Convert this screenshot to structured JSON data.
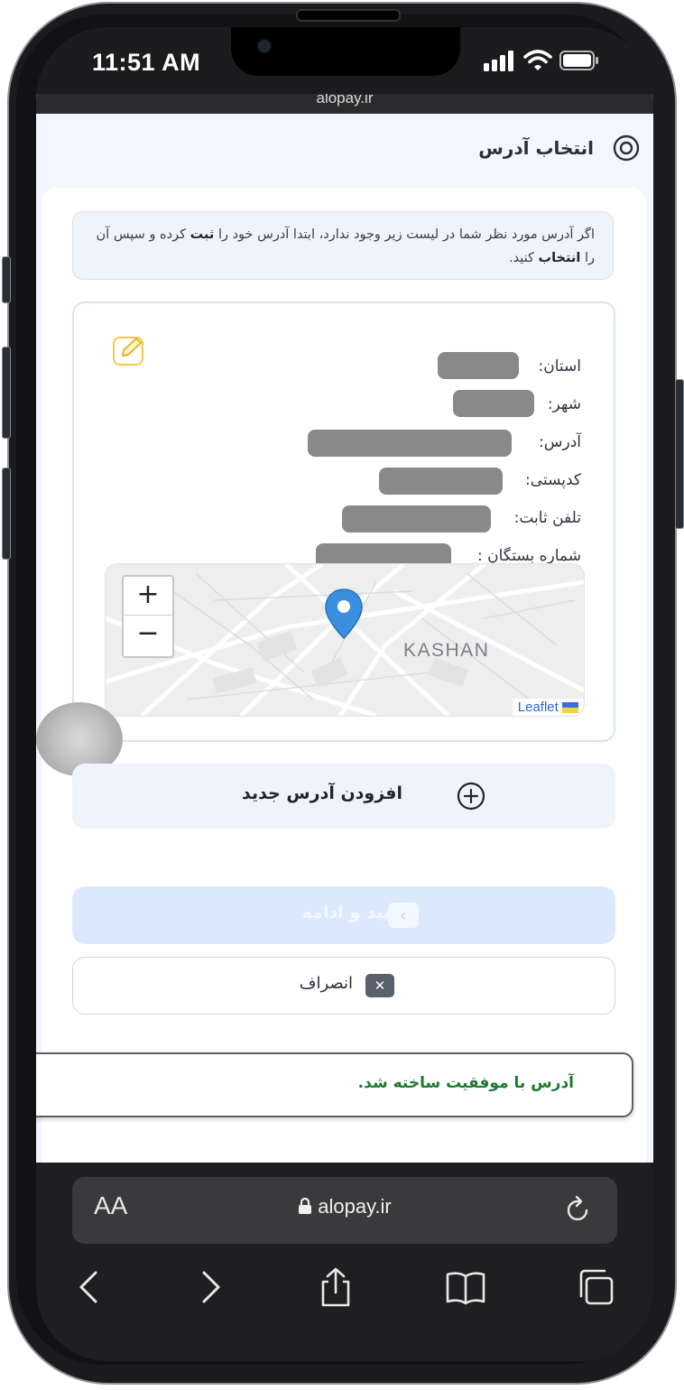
{
  "status_bar": {
    "time": "11:51 AM"
  },
  "page": {
    "url_strip": "alopay.ir",
    "title": "انتخاب آدرس"
  },
  "info": {
    "text_1": "اگر آدرس مورد نظر شما در لیست زیر وجود ندارد، ابتدا آدرس خود را",
    "bold_1": "ثبت",
    "text_2": "کرده و سپس آن را",
    "bold_2": "انتخاب",
    "text_3": "کنید."
  },
  "address": {
    "province_label": "استان:",
    "city_label": "شهر:",
    "address_label": "آدرس:",
    "postal_label": "کدپستی:",
    "phone_label": "تلفن ثابت:",
    "relative_label": "شماره بستگان :"
  },
  "map": {
    "zoom_in": "+",
    "zoom_out": "−",
    "city": "KASHAN",
    "attribution": "Leaflet"
  },
  "actions": {
    "add_address": "افزودن آدرس جدید",
    "confirm": "تایید و ادامه",
    "cancel": "انصراف"
  },
  "toast": {
    "message": "آدرس با موفقیت ساخته شد."
  },
  "safari": {
    "aa": "AA",
    "url": "alopay.ir"
  },
  "colors": {
    "accent": "#3b8fe0",
    "success": "#1e7a2e",
    "confirm_disabled": "#dce9fd"
  }
}
